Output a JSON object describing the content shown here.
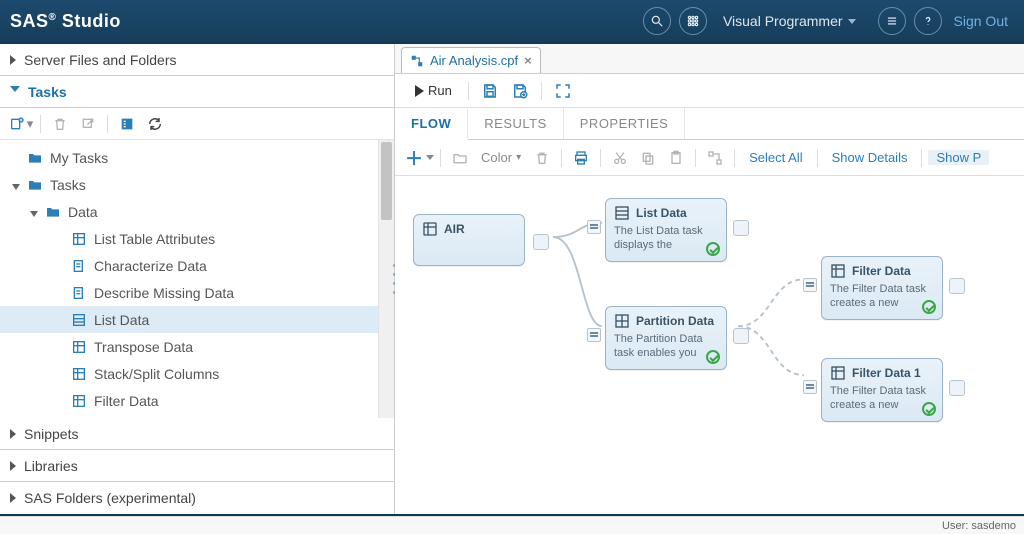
{
  "app": {
    "title_a": "SAS",
    "title_b": " Studio"
  },
  "top": {
    "role": "Visual Programmer",
    "signout": "Sign Out"
  },
  "side": {
    "sections": {
      "files": "Server Files and Folders",
      "tasks": "Tasks",
      "snippets": "Snippets",
      "libraries": "Libraries",
      "sasfolders": "SAS Folders (experimental)"
    },
    "tree": {
      "mytasks": "My Tasks",
      "tasks": "Tasks",
      "data": "Data",
      "items": [
        "List Table Attributes",
        "Characterize Data",
        "Describe Missing Data",
        "List Data",
        "Transpose Data",
        "Stack/Split Columns",
        "Filter Data"
      ]
    }
  },
  "tab": {
    "label": "Air Analysis.cpf"
  },
  "runbar": {
    "run": "Run"
  },
  "subtabs": {
    "flow": "FLOW",
    "results": "RESULTS",
    "properties": "PROPERTIES"
  },
  "tb2": {
    "color": "Color",
    "selectall": "Select All",
    "showdetails": "Show Details",
    "showports": "Show P"
  },
  "nodes": {
    "air": {
      "title": "AIR"
    },
    "list": {
      "title": "List Data",
      "desc": "The List Data task displays the"
    },
    "part": {
      "title": "Partition Data",
      "desc": "The Partition Data task enables you"
    },
    "f1": {
      "title": "Filter Data",
      "desc": "The Filter Data task creates a new"
    },
    "f2": {
      "title": "Filter Data 1",
      "desc": "The Filter Data task creates a new"
    }
  },
  "status": {
    "user_label": "User:",
    "user": "sasdemo"
  }
}
